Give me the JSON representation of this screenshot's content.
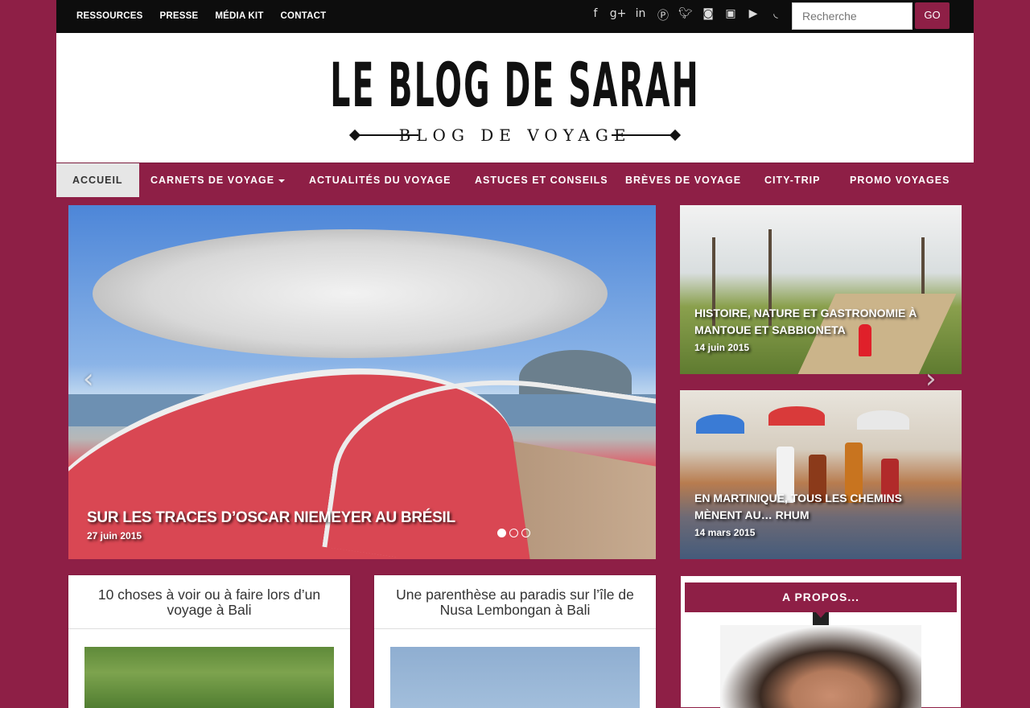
{
  "topbar": {
    "links": [
      "RESSOURCES",
      "PRESSE",
      "MÉDIA KIT",
      "CONTACT"
    ],
    "social_icons": [
      "facebook-icon",
      "google-plus-icon",
      "linkedin-icon",
      "pinterest-icon",
      "twitter-icon",
      "instagram-icon",
      "vimeo-icon",
      "youtube-icon",
      "rss-icon"
    ],
    "search_placeholder": "Recherche",
    "search_button": "GO"
  },
  "header": {
    "title": "LE BLOG DE SARAH",
    "subtitle": "BLOG DE VOYAGE"
  },
  "nav": {
    "items": [
      "ACCUEIL",
      "CARNETS DE VOYAGE",
      "ACTUALITÉS DU VOYAGE",
      "ASTUCES ET CONSEILS",
      "BRÈVES DE VOYAGE",
      "CITY-TRIP",
      "PROMO VOYAGES"
    ],
    "active": "ACCUEIL"
  },
  "slider": {
    "title": "SUR LES TRACES D’OSCAR NIEMEYER AU BRÉSIL",
    "date": "27 juin 2015",
    "slide_count": 3,
    "active_slide": 1
  },
  "featured": [
    {
      "title": "HISTOIRE, NATURE ET GASTRONOMIE À MANTOUE ET SABBIONETA",
      "date": "14 juin 2015"
    },
    {
      "title": "EN MARTINIQUE, TOUS LES CHEMINS MÈNENT AU… RHUM",
      "date": "14 mars 2015"
    }
  ],
  "posts": [
    {
      "title": "10 choses à voir ou à faire lors d’un voyage à Bali"
    },
    {
      "title": "Une parenthèse au paradis sur l’île de Nusa Lembongan à Bali"
    }
  ],
  "about": {
    "title": "A PROPOS..."
  },
  "colors": {
    "brand": "#8e1f46",
    "topbar": "#0d0d0d"
  }
}
